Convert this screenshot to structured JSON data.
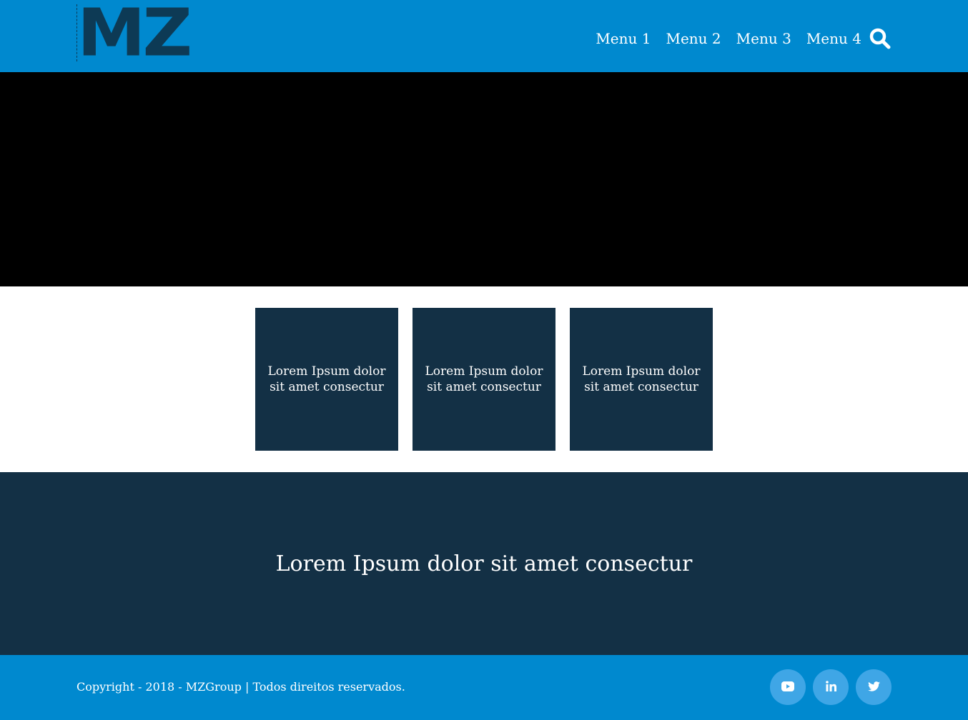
{
  "header": {
    "logo_text": "MZ",
    "nav": [
      {
        "label": "Menu 1"
      },
      {
        "label": "Menu 2"
      },
      {
        "label": "Menu 3"
      },
      {
        "label": "Menu 4"
      }
    ],
    "search_icon": "search-icon"
  },
  "cards": [
    {
      "text": "Lorem Ipsum dolor sit amet consectur"
    },
    {
      "text": "Lorem Ipsum dolor sit amet consectur"
    },
    {
      "text": "Lorem Ipsum dolor sit amet consectur"
    }
  ],
  "band": {
    "text": "Lorem Ipsum dolor sit amet consectur"
  },
  "footer": {
    "copyright": "Copyright - 2018 - MZGroup | Todos direitos reservados.",
    "social": [
      {
        "icon": "youtube-icon"
      },
      {
        "icon": "linkedin-icon"
      },
      {
        "icon": "twitter-icon"
      }
    ]
  },
  "colors": {
    "primary_blue": "#0089cf",
    "dark_navy": "#133045",
    "logo_navy": "#0d3a55",
    "social_circle": "#3fa6e6",
    "hero": "#000000"
  }
}
